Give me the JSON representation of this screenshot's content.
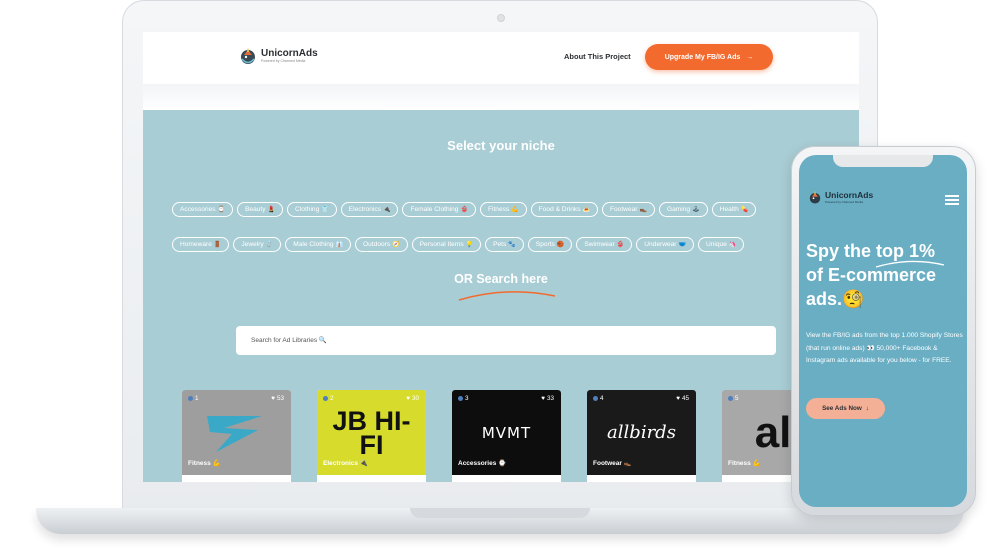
{
  "brand": {
    "name": "UnicornAds",
    "tagline": "Powered by Charmed Media"
  },
  "header": {
    "about_label": "About This Project",
    "upgrade_label": "Upgrade My FB/IG Ads",
    "upgrade_arrow": "→"
  },
  "niche": {
    "title": "Select your niche",
    "row1": [
      {
        "label": "Accessories",
        "emoji": "⌚"
      },
      {
        "label": "Beauty",
        "emoji": "💄"
      },
      {
        "label": "Clothing",
        "emoji": "👕"
      },
      {
        "label": "Electronics",
        "emoji": "🔌"
      },
      {
        "label": "Female Clothing",
        "emoji": "👙"
      },
      {
        "label": "Fitness",
        "emoji": "💪"
      },
      {
        "label": "Food & Drinks",
        "emoji": "🍝"
      },
      {
        "label": "Footwear",
        "emoji": "👞"
      },
      {
        "label": "Gaming",
        "emoji": "🕹"
      },
      {
        "label": "Health",
        "emoji": "💊"
      }
    ],
    "row2": [
      {
        "label": "Homeware",
        "emoji": "🚪"
      },
      {
        "label": "Jewelry",
        "emoji": "💍"
      },
      {
        "label": "Male Clothing",
        "emoji": "👔"
      },
      {
        "label": "Outdoors",
        "emoji": "🧭"
      },
      {
        "label": "Personal Items",
        "emoji": "💡"
      },
      {
        "label": "Pets",
        "emoji": "🐾"
      },
      {
        "label": "Sports",
        "emoji": "🏀"
      },
      {
        "label": "Swimwear",
        "emoji": "👙"
      },
      {
        "label": "Underwear",
        "emoji": "🩲"
      },
      {
        "label": "Unique",
        "emoji": "🦄"
      }
    ]
  },
  "search": {
    "heading": "OR Search here",
    "placeholder": "Search for Ad Libraries 🔍"
  },
  "cards": [
    {
      "rank": "1",
      "likes": "53",
      "category": "Fitness 💪",
      "logo_text": "",
      "bg": "#9e9e9e"
    },
    {
      "rank": "2",
      "likes": "30",
      "category": "Electronics 🔌",
      "logo_text": "JB HI-FI",
      "bg": "#d7dc2c"
    },
    {
      "rank": "3",
      "likes": "33",
      "category": "Accessories ⌚",
      "logo_text": "MVMT",
      "bg": "#0d0d0d"
    },
    {
      "rank": "4",
      "likes": "45",
      "category": "Footwear 👞",
      "logo_text": "allbirds",
      "bg": "#1a1a1a"
    },
    {
      "rank": "5",
      "likes": "",
      "category": "Fitness 💪",
      "logo_text": "alo",
      "bg": "#a8a8a8"
    }
  ],
  "mobile": {
    "headline_1": "Spy the top 1%",
    "headline_2": "of E-commerce",
    "headline_3": "ads.🧐",
    "description": "View the FB/IG ads from the top 1.000 Shopify Stores (that run online ads) 👀 50,000+ Facebook & Instagram ads available for you below - for FREE.",
    "cta_label": "See Ads Now",
    "cta_arrow": "↓"
  },
  "colors": {
    "accent": "#f26a2e",
    "section_bg": "#a9cdd4",
    "mobile_bg": "#6aaec3",
    "cta_mobile": "#f4b096"
  }
}
